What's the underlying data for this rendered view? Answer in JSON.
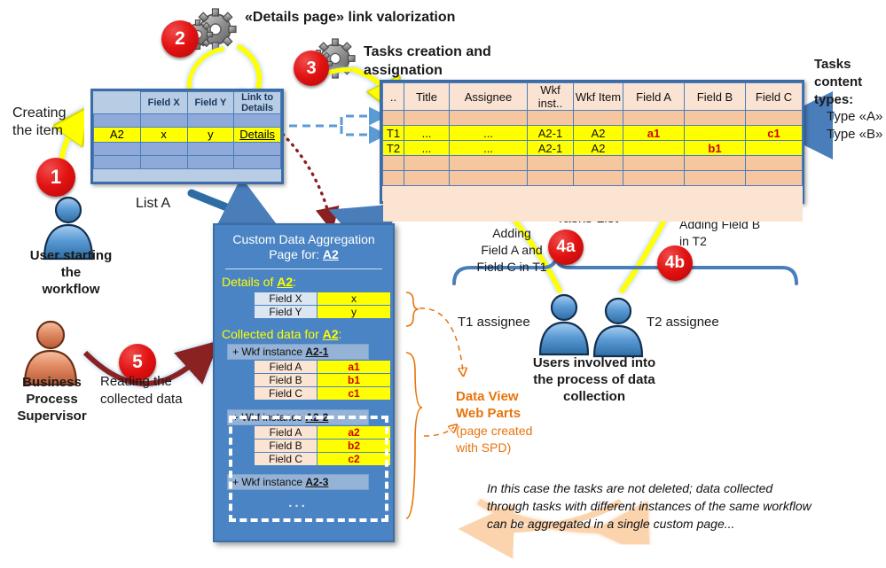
{
  "steps": [
    {
      "id": "1",
      "label": "1"
    },
    {
      "id": "2",
      "label": "2"
    },
    {
      "id": "3",
      "label": "3"
    },
    {
      "id": "4a",
      "label": "4a"
    },
    {
      "id": "4b",
      "label": "4b"
    },
    {
      "id": "5",
      "label": "5"
    }
  ],
  "annotations": {
    "details_link_valorization": "«Details page» link valorization",
    "tasks_creation": "Tasks creation and\nassignation",
    "creating_the_item": "Creating\nthe item",
    "user_starting_workflow": "User starting\nthe\nworkflow",
    "business_process_supervisor": "Business\nProcess\nSupervisor",
    "reading_collected_data": "Reading the\ncollected data",
    "list_a_caption": "List A",
    "tasks_list_caption": "Tasks List",
    "adding_field_ac_t1": "Adding\nField A and\nField C in T1",
    "adding_field_b_t2": "Adding Field B\nin T2",
    "t1_assignee": "T1 assignee",
    "t2_assignee": "T2 assignee",
    "users_involved": "Users involved into\nthe process of data\ncollection",
    "tasks_content_types": "Tasks\ncontent\ntypes:",
    "type_a": "Type «A»",
    "type_b": "Type «B»",
    "data_view_web_parts_bold": "Data View\nWeb Parts",
    "data_view_web_parts_sub": "(page created\nwith SPD)",
    "footer_note": "In this case the tasks are not deleted; data collected\nthrough tasks with different instances of the same workflow\ncan be aggregated in a single custom page..."
  },
  "list_a": {
    "columns": [
      "",
      "Field X",
      "Field Y",
      "Link to Details"
    ],
    "rows": [
      {
        "cells": [
          "",
          "",
          "",
          ""
        ],
        "highlight": false
      },
      {
        "cells": [
          "A2",
          "x",
          "y",
          "Details"
        ],
        "highlight": true,
        "link_index": 3
      },
      {
        "cells": [
          "",
          "",
          "",
          ""
        ],
        "highlight": false
      },
      {
        "cells": [
          "",
          "",
          "",
          ""
        ],
        "highlight": false
      }
    ]
  },
  "tasks_list": {
    "columns": [
      "..",
      "Title",
      "Assignee",
      "Wkf inst..",
      "Wkf Item",
      "Field A",
      "Field B",
      "Field C"
    ],
    "rows": [
      {
        "cells": [
          "",
          "",
          "",
          "",
          "",
          "",
          "",
          ""
        ],
        "highlight": false,
        "gray": []
      },
      {
        "cells": [
          "T1",
          "...",
          "...",
          "A2-1",
          "A2",
          "a1",
          "",
          "c1"
        ],
        "highlight": true,
        "gray": [
          6
        ],
        "red": [
          5,
          7
        ]
      },
      {
        "cells": [
          "T2",
          "...",
          "...",
          "A2-1",
          "A2",
          "",
          "b1",
          ""
        ],
        "highlight": true,
        "gray": [
          5,
          7
        ],
        "red": [
          6
        ]
      },
      {
        "cells": [
          "",
          "",
          "",
          "",
          "",
          "",
          "",
          ""
        ],
        "highlight": false,
        "gray": []
      },
      {
        "cells": [
          "",
          "",
          "",
          "",
          "",
          "",
          "",
          ""
        ],
        "highlight": false,
        "gray": []
      }
    ]
  },
  "panel": {
    "title_line1": "Custom Data Aggregation",
    "title_line2_prefix": "Page for: ",
    "title_item": "A2",
    "details_heading_prefix": "Details of ",
    "details_heading_item": "A2",
    "details_heading_suffix": ":",
    "details_rows": [
      {
        "label": "Field X",
        "value": "x"
      },
      {
        "label": "Field Y",
        "value": "y"
      }
    ],
    "collected_heading_prefix": "Collected data for ",
    "collected_heading_item": "A2",
    "collected_heading_suffix": ":",
    "instances": [
      {
        "bar_prefix": "+ Wkf instance ",
        "bar_item": "A2-1",
        "rows": [
          {
            "label": "Field A",
            "value": "a1"
          },
          {
            "label": "Field B",
            "value": "b1"
          },
          {
            "label": "Field C",
            "value": "c1"
          }
        ]
      },
      {
        "bar_prefix": "+ Wkf instance ",
        "bar_item": "A2-2",
        "rows": [
          {
            "label": "Field A",
            "value": "a2"
          },
          {
            "label": "Field B",
            "value": "b2"
          },
          {
            "label": "Field C",
            "value": "c2"
          }
        ]
      },
      {
        "bar_prefix": "+ Wkf instance ",
        "bar_item": "A2-3",
        "rows": []
      }
    ],
    "ellipsis": "..."
  },
  "colors": {
    "accent_blue": "#4a84c4",
    "table_border": "#3c6ca8",
    "highlight_yellow": "#ffff00",
    "red_badge": "#e21212",
    "orange_text": "#e8740c",
    "orange_row": "#f5c6a0",
    "gray_cell": "#bfbfbf",
    "red_value": "#d00000"
  }
}
